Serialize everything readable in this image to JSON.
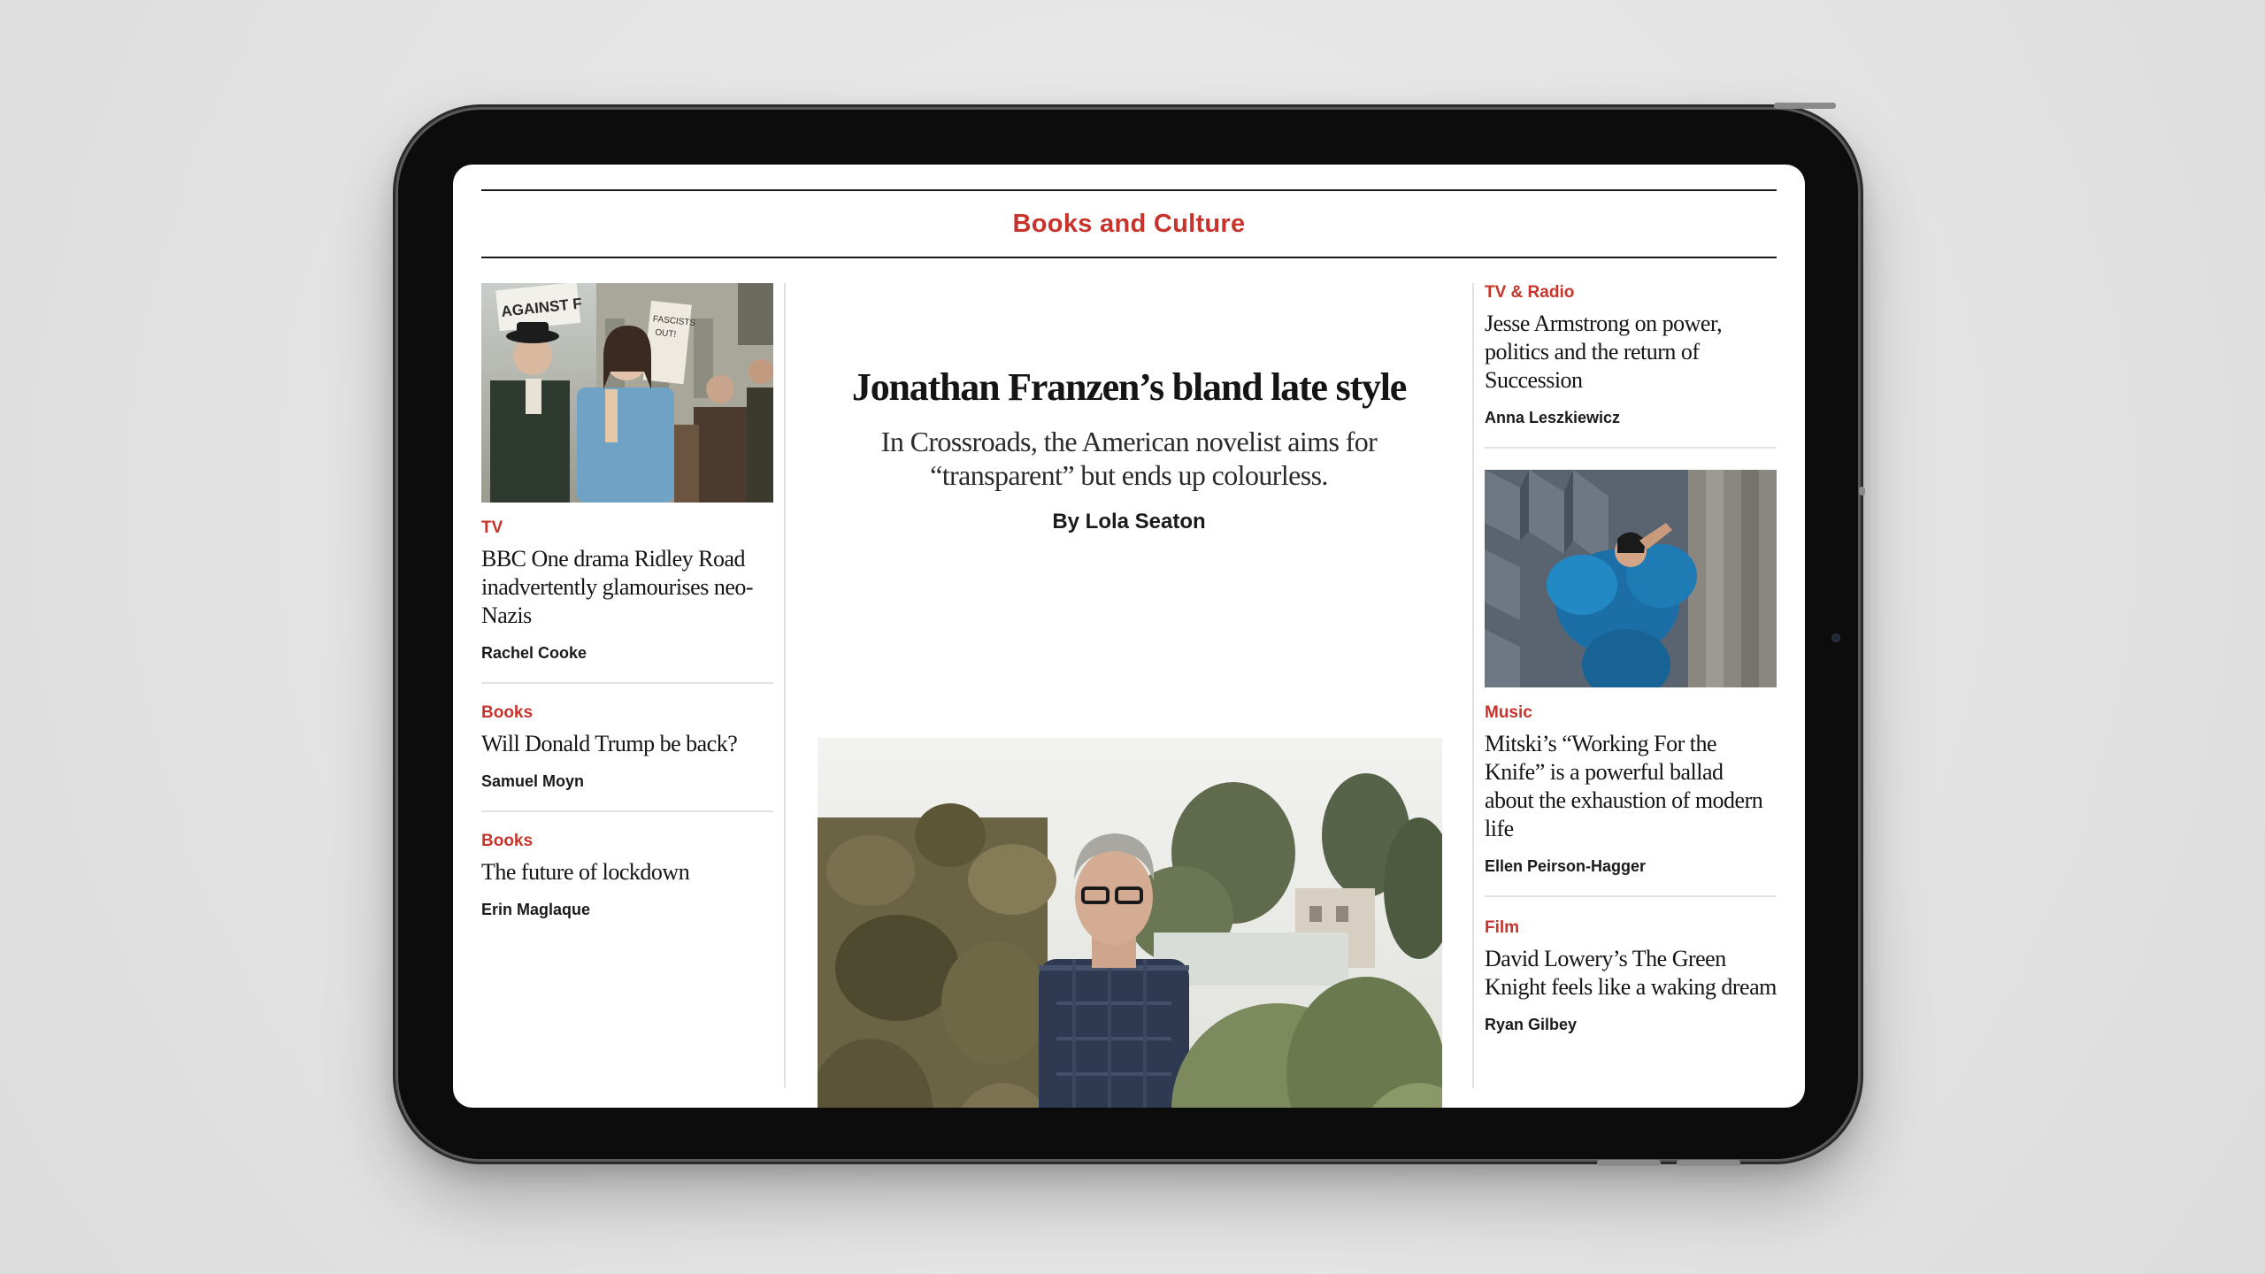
{
  "section": {
    "title": "Books and Culture"
  },
  "left": {
    "articles": [
      {
        "kicker": "TV",
        "headline": "BBC One drama Ridley Road inadvertently glamourises neo-Nazis",
        "author": "Rachel Cooke",
        "image": "protest-crowd-photo"
      },
      {
        "kicker": "Books",
        "headline": "Will Donald Trump be back?",
        "author": "Samuel Moyn"
      },
      {
        "kicker": "Books",
        "headline": "The future of lockdown",
        "author": "Erin Maglaque"
      }
    ]
  },
  "feature": {
    "title": "Jonathan Franzen’s bland late style",
    "standfirst": "In Crossroads, the American novelist aims for “transparent” but ends up colourless.",
    "byline": "By Lola Seaton",
    "image": "man-in-garden-photo"
  },
  "right": {
    "articles": [
      {
        "kicker": "TV & Radio",
        "headline": "Jesse Armstrong on power, politics and the return of Succession",
        "author": "Anna Leszkiewicz"
      },
      {
        "kicker": "Music",
        "headline": "Mitski’s “Working For the Knife” is a powerful ballad about the exhaustion of modern life",
        "author": "Ellen Peirson-Hagger",
        "image": "singer-blue-dress-photo"
      },
      {
        "kicker": "Film",
        "headline": "David Lowery’s The Green Knight feels like a waking dream",
        "author": "Ryan Gilbey"
      }
    ]
  },
  "colors": {
    "accent": "#c8342c",
    "text": "#141414",
    "divider": "#e2e2e2"
  },
  "protest_signs": {
    "sign1": "AGAINST F",
    "sign2": "FASCISTS OUT!"
  }
}
